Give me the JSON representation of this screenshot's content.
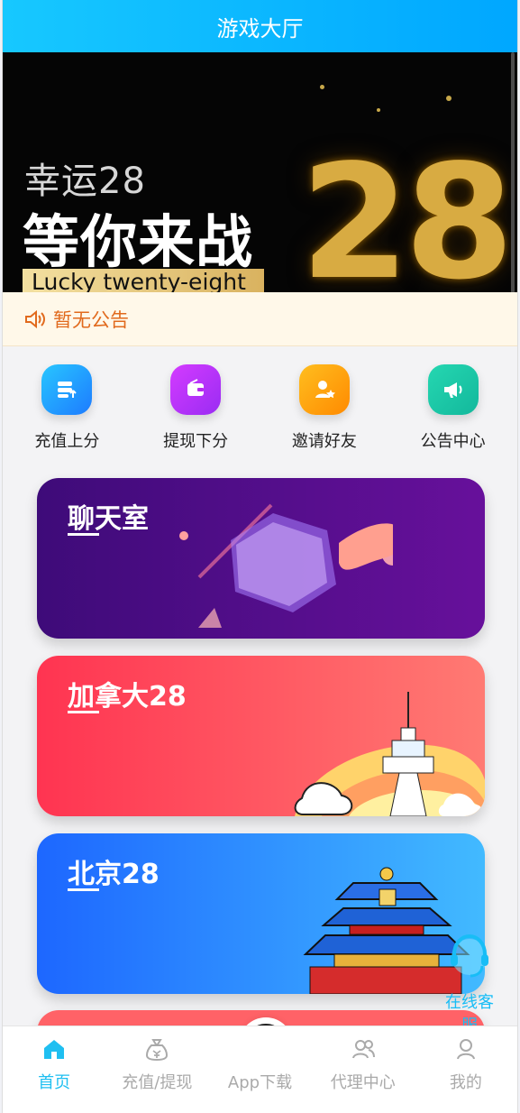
{
  "header": {
    "title": "游戏大厅"
  },
  "banner": {
    "line1": "幸运28",
    "line2": "等你来战",
    "tag": "Lucky twenty-eight",
    "number": "28"
  },
  "notice": {
    "text": "暂无公告"
  },
  "quick_actions": [
    {
      "label": "充值上分",
      "icon": "recharge-icon",
      "color": "#1d96ff"
    },
    {
      "label": "提现下分",
      "icon": "withdraw-icon",
      "color": "#b829ef"
    },
    {
      "label": "邀请好友",
      "icon": "invite-icon",
      "color": "#ffa000"
    },
    {
      "label": "公告中心",
      "icon": "announcement-icon",
      "color": "#11cda6"
    }
  ],
  "cards": [
    {
      "title": "聊天室"
    },
    {
      "title": "加拿大28"
    },
    {
      "title": "北京28"
    }
  ],
  "service": {
    "label": "在线客服"
  },
  "bottom_nav": [
    {
      "label": "首页",
      "active": true
    },
    {
      "label": "充值/提现"
    },
    {
      "label": "App下载"
    },
    {
      "label": "代理中心"
    },
    {
      "label": "我的"
    }
  ]
}
